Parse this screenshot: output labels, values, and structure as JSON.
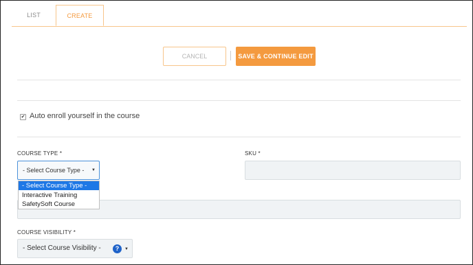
{
  "tabs": [
    {
      "label": "LIST",
      "active": false
    },
    {
      "label": "CREATE",
      "active": true
    }
  ],
  "actions": {
    "cancel_label": "CANCEL",
    "save_label": "SAVE & CONTINUE EDIT"
  },
  "auto_enroll": {
    "checked": true,
    "label": "Auto enroll yourself in the course"
  },
  "course_type": {
    "label": "COURSE TYPE *",
    "selected": "- Select Course Type -",
    "options": [
      "- Select Course Type -",
      "Interactive Training",
      "SafetySoft Course"
    ],
    "caret": "▼"
  },
  "sku": {
    "label": "SKU *",
    "value": ""
  },
  "course_visibility": {
    "label": "COURSE VISIBILITY *",
    "selected": "- Select Course Visibility -",
    "caret": "▼",
    "help_glyph": "?"
  },
  "colors": {
    "accent": "#f49a3f",
    "selected_option": "#1e78e6",
    "help_icon": "#1f63c9"
  }
}
